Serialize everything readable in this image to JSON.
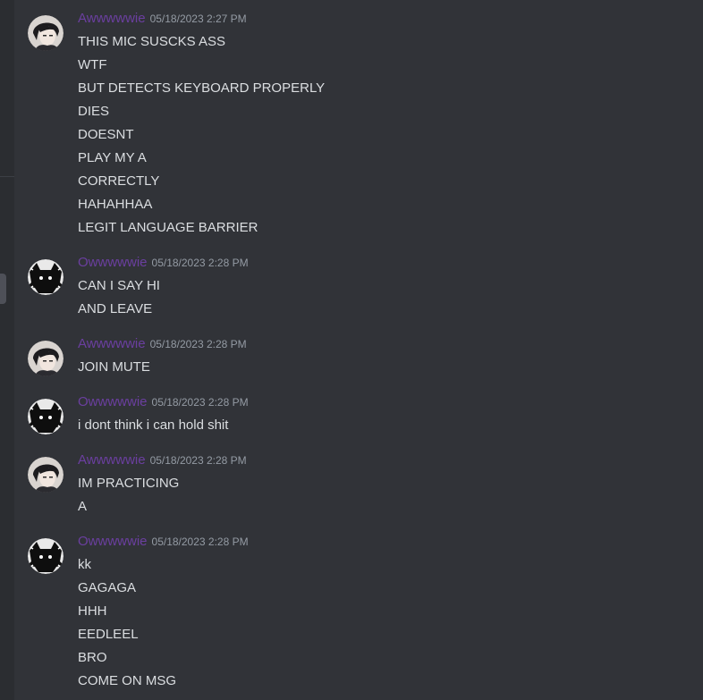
{
  "groups": [
    {
      "avatar": "avatar-anime-man",
      "username": "Awwwwwie",
      "timestamp": "05/18/2023 2:27 PM",
      "lines": [
        "THIS MIC SUSCKS ASS",
        "WTF",
        "BUT DETECTS KEYBOARD PROPERLY",
        "DIES",
        "DOESNT",
        "PLAY MY A",
        "CORRECTLY",
        "HAHAHHAA",
        "LEGIT LANGUAGE BARRIER"
      ]
    },
    {
      "avatar": "avatar-dark-cat",
      "username": "Owwwwwie",
      "timestamp": "05/18/2023 2:28 PM",
      "lines": [
        "CAN I SAY HI",
        "AND LEAVE"
      ]
    },
    {
      "avatar": "avatar-anime-man",
      "username": "Awwwwwie",
      "timestamp": "05/18/2023 2:28 PM",
      "lines": [
        "JOIN MUTE"
      ]
    },
    {
      "avatar": "avatar-dark-cat",
      "username": "Owwwwwie",
      "timestamp": "05/18/2023 2:28 PM",
      "lines": [
        "i dont think i can hold shit"
      ]
    },
    {
      "avatar": "avatar-anime-man",
      "username": "Awwwwwie",
      "timestamp": "05/18/2023 2:28 PM",
      "lines": [
        "IM PRACTICING",
        "A"
      ]
    },
    {
      "avatar": "avatar-dark-cat",
      "username": "Owwwwwie",
      "timestamp": "05/18/2023 2:28 PM",
      "lines": [
        "kk",
        "GAGAGA",
        "HHH",
        "EEDLEEL",
        "BRO",
        "COME ON MSG"
      ]
    }
  ],
  "colors": {
    "background": "#313338",
    "username": "#6b3fa0",
    "message_text": "#dbdee1",
    "timestamp": "#949ba4"
  }
}
